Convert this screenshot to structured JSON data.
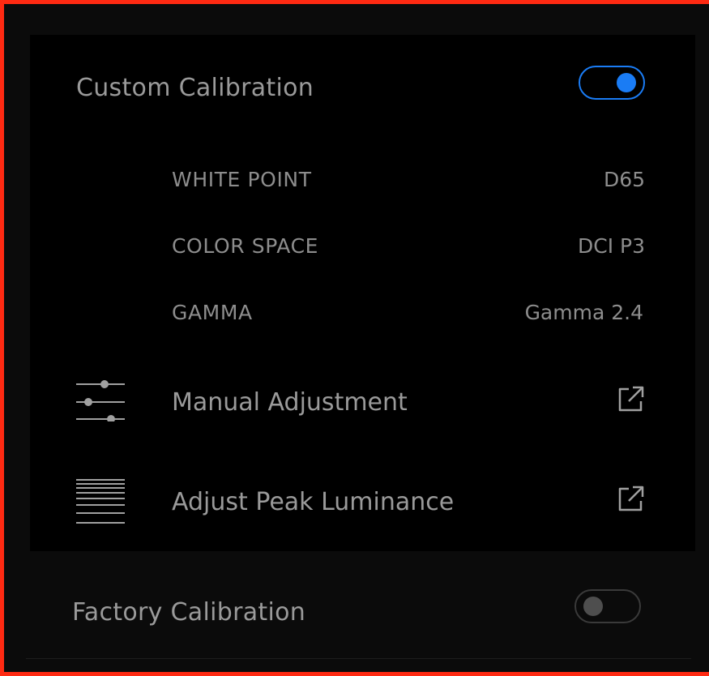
{
  "custom_calibration": {
    "title": "Custom Calibration",
    "enabled": true,
    "properties": [
      {
        "label": "WHITE POINT",
        "value": "D65"
      },
      {
        "label": "COLOR SPACE",
        "value": "DCI P3"
      },
      {
        "label": "GAMMA",
        "value": "Gamma 2.4"
      }
    ],
    "actions": [
      {
        "label": "Manual Adjustment",
        "icon": "sliders-icon",
        "trailing_icon": "external-link-icon"
      },
      {
        "label": "Adjust Peak Luminance",
        "icon": "luminance-lines-icon",
        "trailing_icon": "external-link-icon"
      }
    ]
  },
  "factory_calibration": {
    "title": "Factory Calibration",
    "enabled": false
  },
  "colors": {
    "accent": "#1a7cf5",
    "frame_border": "#ff2a12",
    "text": "#9a9a9a"
  }
}
